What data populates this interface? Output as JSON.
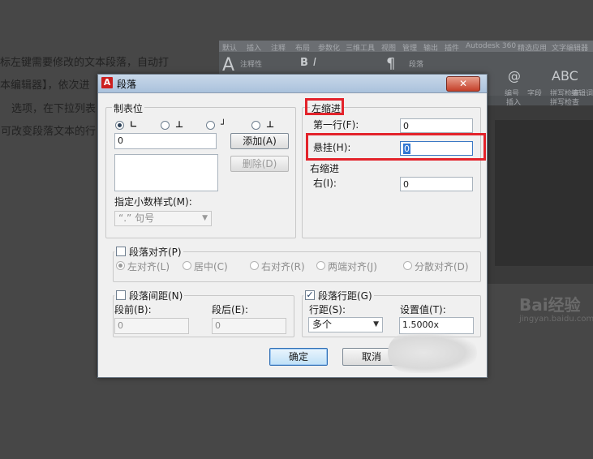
{
  "background": {
    "page_lines": [
      "标左键需要修改的文本段落，自动打",
      "本编辑器】，依次进",
      "选项，在下拉列表",
      "可改变段落文本的行"
    ],
    "ribbon_tabs": [
      "默认",
      "插入",
      "注释",
      "布局",
      "参数化",
      "三维工具",
      "视图",
      "管理",
      "输出",
      "插件",
      "Autodesk 360",
      "精选应用",
      "文字编辑器"
    ],
    "ribbon_labels": [
      "注释性",
      "段落",
      "编号",
      "字段",
      "插入",
      "拼写检查",
      "编辑词典",
      "拼写检查"
    ],
    "watermark": "Bai经验",
    "watermark_sub": "jingyan.baidu.com"
  },
  "dialog": {
    "title": "段落",
    "close_glyph": "✕",
    "tabs_group": {
      "title": "制表位",
      "input_value": "0",
      "add_button": "添加(A)",
      "delete_button": "删除(D)",
      "decimal_label": "指定小数样式(M):",
      "decimal_value": "“.”  句号"
    },
    "left_indent": {
      "title": "左缩进",
      "first_line_label": "第一行(F):",
      "first_line_value": "0",
      "hanging_label": "悬挂(H):",
      "hanging_value": "0"
    },
    "right_indent": {
      "title": "右缩进",
      "right_label": "右(I):",
      "right_value": "0"
    },
    "alignment": {
      "title": "段落对齐(P)",
      "options": [
        "左对齐(L)",
        "居中(C)",
        "右对齐(R)",
        "两端对齐(J)",
        "分散对齐(D)"
      ]
    },
    "spacing": {
      "title": "段落间距(N)",
      "before_label": "段前(B):",
      "before_value": "0",
      "after_label": "段后(E):",
      "after_value": "0"
    },
    "line_spacing": {
      "title": "段落行距(G)",
      "spacing_label": "行距(S):",
      "spacing_value": "多个",
      "setting_label": "设置值(T):",
      "setting_value": "1.5000x"
    },
    "ok_button": "确定",
    "cancel_button": "取消"
  }
}
